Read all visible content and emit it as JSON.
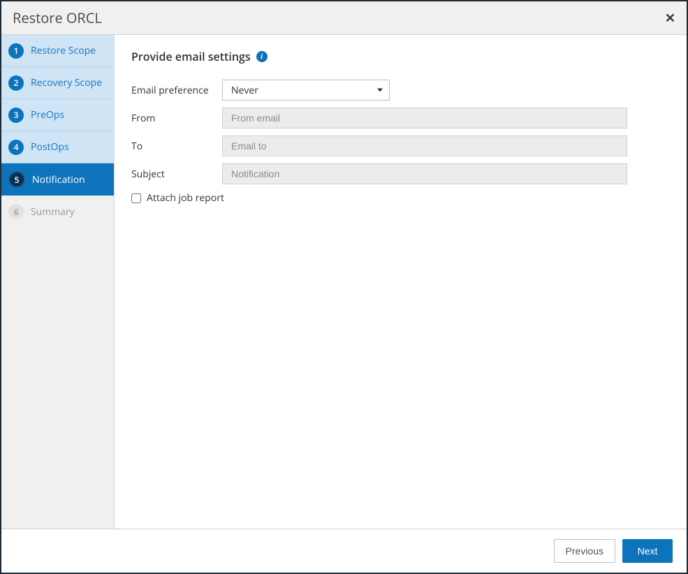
{
  "modal": {
    "title": "Restore ORCL"
  },
  "sidebar": {
    "steps": [
      {
        "num": "1",
        "label": "Restore Scope"
      },
      {
        "num": "2",
        "label": "Recovery Scope"
      },
      {
        "num": "3",
        "label": "PreOps"
      },
      {
        "num": "4",
        "label": "PostOps"
      },
      {
        "num": "5",
        "label": "Notification"
      },
      {
        "num": "6",
        "label": "Summary"
      }
    ]
  },
  "content": {
    "heading": "Provide email settings",
    "labels": {
      "preference": "Email preference",
      "from": "From",
      "to": "To",
      "subject": "Subject",
      "attach": "Attach job report"
    },
    "preference_value": "Never",
    "from_placeholder": "From email",
    "to_placeholder": "Email to",
    "subject_placeholder": "Notification"
  },
  "footer": {
    "previous": "Previous",
    "next": "Next"
  }
}
